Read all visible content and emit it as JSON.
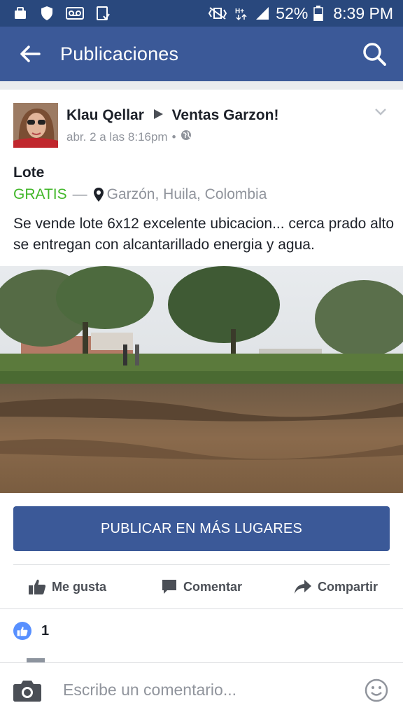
{
  "status_bar": {
    "battery": "52%",
    "time": "8:39 PM",
    "icons": [
      "bag-icon",
      "shield-icon",
      "voicemail-icon",
      "clipboard-icon",
      "vibrate-icon",
      "signal-h-icon",
      "cell-signal-icon",
      "battery-icon"
    ]
  },
  "app_bar": {
    "title": "Publicaciones",
    "icons": [
      "back-arrow-icon",
      "search-icon"
    ]
  },
  "post": {
    "author": "Klau Qellar",
    "group": "Ventas Garzon!",
    "timestamp": "abr. 2 a las 8:16pm",
    "privacy_icon": "globe-icon",
    "item_title": "Lote",
    "price": "GRATIS",
    "location": "Garzón, Huila, Colombia",
    "description": "Se vende lote 6x12 excelente ubicacion... cerca prado alto se entregan con alcantarillado energia y agua.",
    "cta_label": "PUBLICAR EN MÁS LUGARES"
  },
  "actions": {
    "like": "Me gusta",
    "comment": "Comentar",
    "share": "Compartir"
  },
  "reactions": {
    "count": "1"
  },
  "comment_bar": {
    "placeholder": "Escribe un comentario..."
  },
  "colors": {
    "status_bar": "#29487d",
    "app_bar": "#3b5998",
    "price_green": "#42b72a",
    "muted_text": "#90949c"
  }
}
